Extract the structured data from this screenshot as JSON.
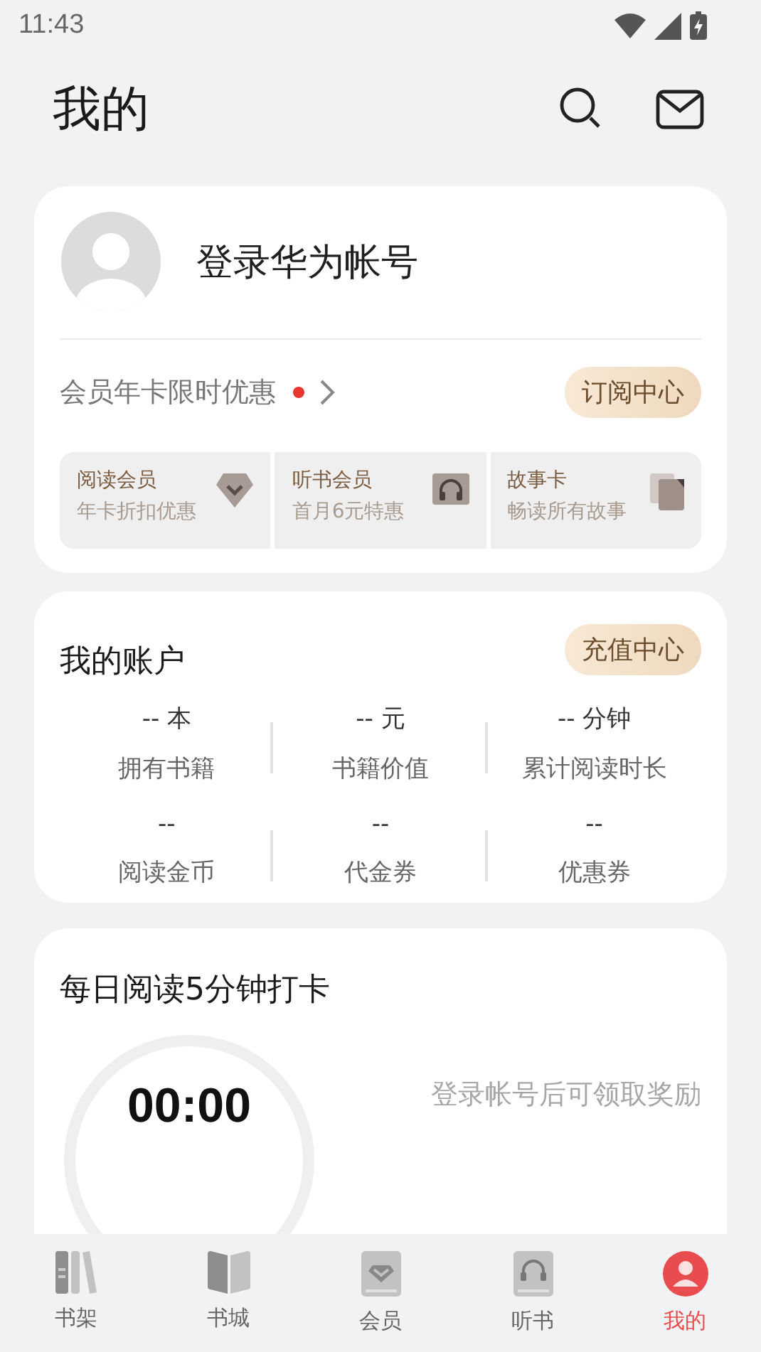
{
  "status_bar": {
    "time": "11:43"
  },
  "header": {
    "title": "我的"
  },
  "profile": {
    "login_text": "登录华为帐号"
  },
  "promo": {
    "text": "会员年卡限时优惠",
    "dot": true,
    "button": "订阅中心"
  },
  "tiles": [
    {
      "kind": "reading",
      "title": "阅读会员",
      "subtitle": "年卡折扣优惠"
    },
    {
      "kind": "audio",
      "title": "听书会员",
      "subtitle": "首月6元特惠"
    },
    {
      "kind": "story",
      "title": "故事卡",
      "subtitle": "畅读所有故事"
    }
  ],
  "account": {
    "title": "我的账户",
    "button": "充值中心",
    "stats": [
      {
        "value": "-- 本",
        "label": "拥有书籍"
      },
      {
        "value": "-- 元",
        "label": "书籍价值"
      },
      {
        "value": "-- 分钟",
        "label": "累计阅读时长"
      },
      {
        "value": "--",
        "label": "阅读金币"
      },
      {
        "value": "--",
        "label": "代金券"
      },
      {
        "value": "--",
        "label": "优惠券"
      }
    ]
  },
  "checkin": {
    "title": "每日阅读5分钟打卡",
    "timer": "00:00",
    "hint": "登录帐号后可领取奖励"
  },
  "nav": [
    {
      "kind": "shelf",
      "label": "书架",
      "selected": false
    },
    {
      "kind": "store",
      "label": "书城",
      "selected": false
    },
    {
      "kind": "vip",
      "label": "会员",
      "selected": false
    },
    {
      "kind": "audio",
      "label": "听书",
      "selected": false
    },
    {
      "kind": "me",
      "label": "我的",
      "selected": true
    }
  ]
}
